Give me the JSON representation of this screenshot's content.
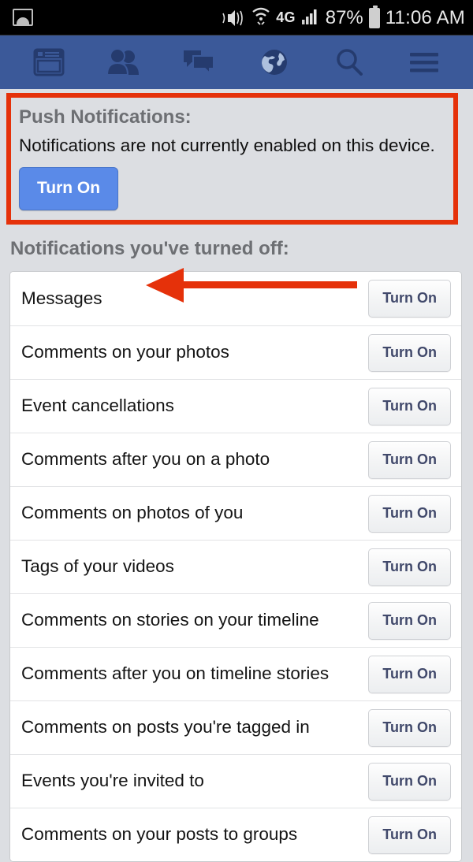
{
  "status_bar": {
    "left_icon": "photo-icon",
    "icons": [
      "mute-icon",
      "wifi-icon",
      "4g-icon",
      "signal-icon"
    ],
    "network_label": "4G",
    "battery_percent": "87%",
    "time": "11:06 AM"
  },
  "nav_bar": {
    "background": "#3b5999",
    "items": [
      {
        "name": "news-feed-icon",
        "label": "News Feed"
      },
      {
        "name": "friend-requests-icon",
        "label": "Friend Requests"
      },
      {
        "name": "messages-icon",
        "label": "Messages"
      },
      {
        "name": "notifications-globe-icon",
        "label": "Notifications"
      },
      {
        "name": "search-icon",
        "label": "Search"
      },
      {
        "name": "menu-icon",
        "label": "Menu"
      }
    ]
  },
  "push_notifications": {
    "title": "Push Notifications:",
    "message": "Notifications are not currently enabled on this device.",
    "button_label": "Turn On",
    "highlight_color": "#e5310a",
    "button_color": "#5a8ae8",
    "annotation": "red-arrow-pointing-to-turn-on-button"
  },
  "turned_off_section": {
    "heading": "Notifications you've turned off:",
    "button_label": "Turn On",
    "rows": [
      {
        "label": "Messages",
        "action": "Turn On"
      },
      {
        "label": "Comments on your photos",
        "action": "Turn On"
      },
      {
        "label": "Event cancellations",
        "action": "Turn On"
      },
      {
        "label": "Comments after you on a photo",
        "action": "Turn On"
      },
      {
        "label": "Comments on photos of you",
        "action": "Turn On"
      },
      {
        "label": "Tags of your videos",
        "action": "Turn On"
      },
      {
        "label": "Comments on stories on your timeline",
        "action": "Turn On"
      },
      {
        "label": "Comments after you on timeline stories",
        "action": "Turn On"
      },
      {
        "label": "Comments on posts you're tagged in",
        "action": "Turn On"
      },
      {
        "label": "Events you're invited to",
        "action": "Turn On"
      },
      {
        "label": "Comments on your posts to groups",
        "action": "Turn On"
      }
    ]
  }
}
